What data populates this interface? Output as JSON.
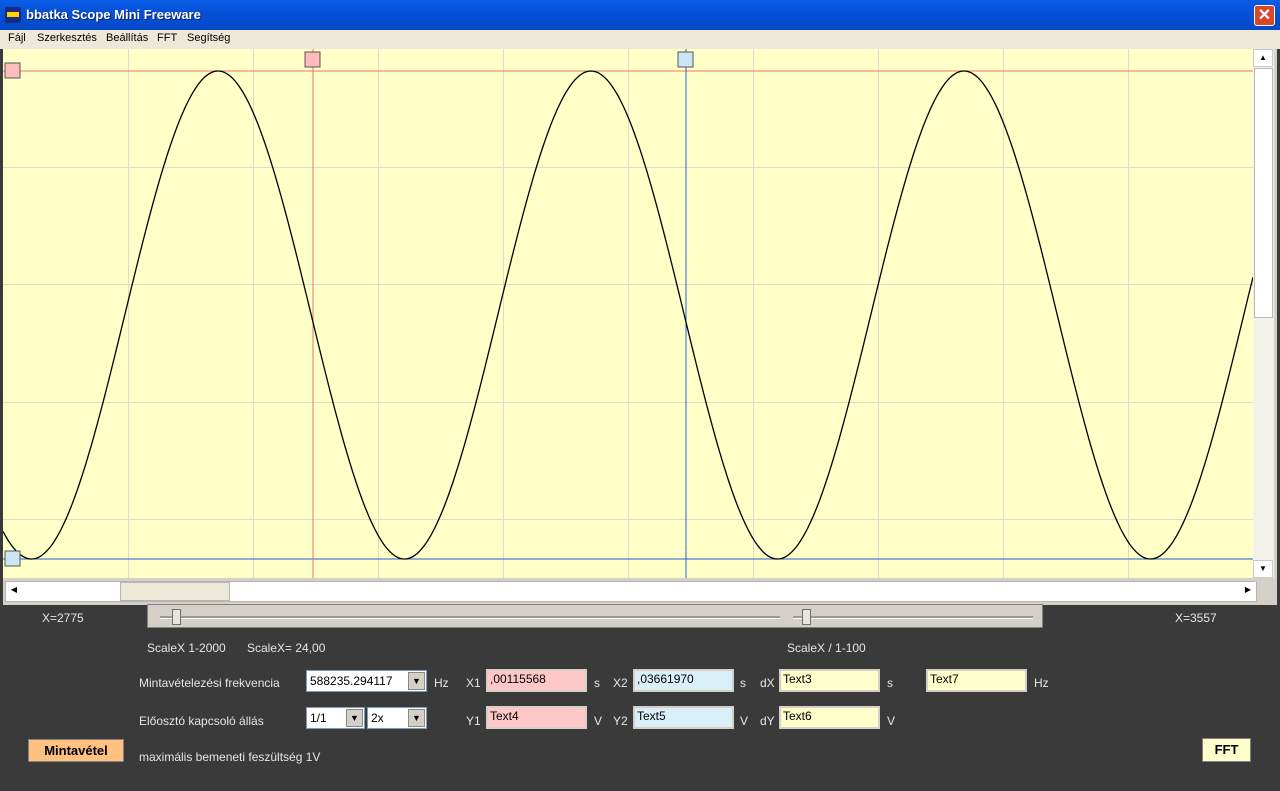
{
  "window": {
    "title": "bbatka Scope Mini Freeware",
    "close_symbol": "✕"
  },
  "menu": [
    "Fájl",
    "Szerkesztés",
    "Beállítás",
    "FFT",
    "Segítség"
  ],
  "colors": {
    "plot_bg": "#ffffc8",
    "wave": "#000000",
    "cursor1": "#f07070",
    "cursor2": "#2060d0"
  },
  "cursors": {
    "x1_pos": 0.248,
    "x2_pos": 0.546
  },
  "footer": {
    "x_left": "X=2775",
    "x_right": "X=3557",
    "scale_range": "ScaleX 1-2000",
    "scale_value": "ScaleX= 24,00",
    "scale_div": "ScaleX / 1-100",
    "slider1_pos": 0.02,
    "slider2_pos": 0.73
  },
  "controls": {
    "sample_rate_label": "Mintavételezési frekvencia",
    "sample_rate_value": "588235.294117",
    "hz1": "Hz",
    "x1_label": "X1",
    "x1_value": ",00115568",
    "s1": "s",
    "x2_label": "X2",
    "x2_value": ",03661970",
    "s2": "s",
    "dx_label": "dX",
    "dx_value": "Text3",
    "s3": "s",
    "freq_value": "Text7",
    "hz2": "Hz",
    "prescaler_label": "Előosztó kapcsoló állás",
    "prescaler_value": "1/1",
    "gain_value": "2x",
    "y1_label": "Y1",
    "y1_value": "Text4",
    "v1": "V",
    "y2_label": "Y2",
    "y2_value": "Text5",
    "v2": "V",
    "dy_label": "dY",
    "dy_value": "Text6",
    "v3": "V",
    "sample_button": "Mintavétel",
    "max_voltage": "maximális bemeneti feszültség  1V",
    "fft_button": "FFT"
  }
}
